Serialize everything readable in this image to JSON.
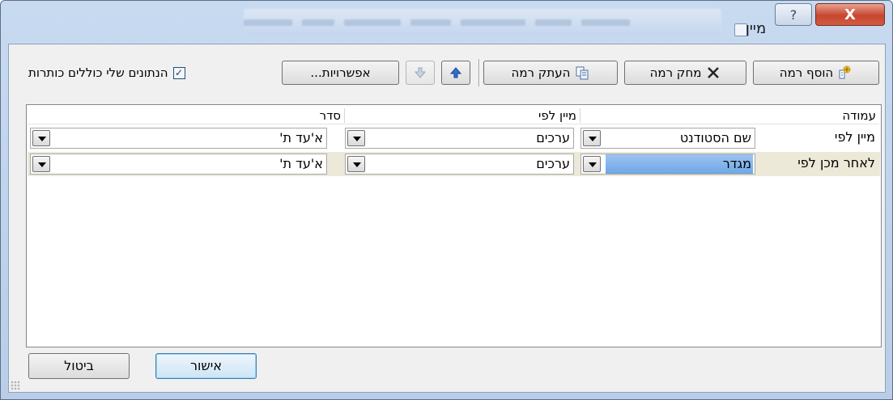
{
  "window": {
    "title": "מיין",
    "help_glyph": "?",
    "close_glyph": "X"
  },
  "toolbar": {
    "add_level": "הוסף רמה",
    "delete_level": "מחק רמה",
    "copy_level": "העתק רמה",
    "options": "אפשרויות...",
    "header_checkbox_label": "הנתונים שלי כוללים כותרות",
    "header_checked": true
  },
  "columns": {
    "column": "עמודה",
    "sort_on": "מיין לפי",
    "order": "סדר"
  },
  "rows": [
    {
      "label": "מיין לפי",
      "column_value": "שם הסטודנט",
      "sort_on": "ערכים",
      "order": "א'עד ת'"
    },
    {
      "label": "לאחר מכן לפי",
      "column_value": "מגדר",
      "sort_on": "ערכים",
      "order": "א'עד ת'"
    }
  ],
  "footer": {
    "ok": "אישור",
    "cancel": "ביטול"
  },
  "colors": {
    "selection_row": "#ece9d8",
    "selection_highlight": "#3399ff",
    "close_button": "#c6472f"
  }
}
